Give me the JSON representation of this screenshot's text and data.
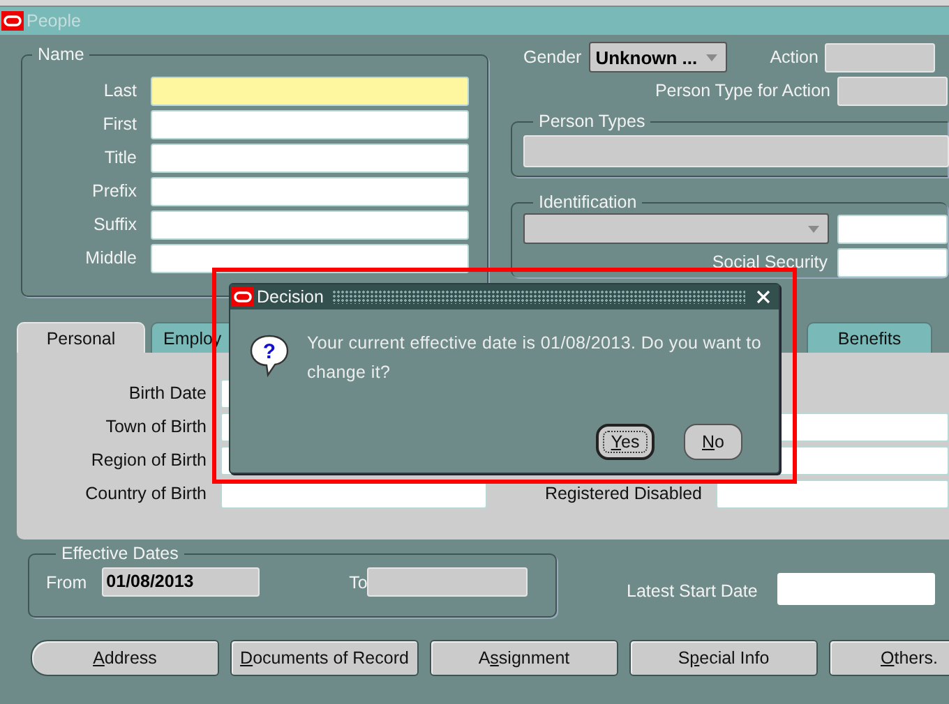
{
  "window": {
    "title": "People"
  },
  "name_group": {
    "title": "Name",
    "fields": [
      {
        "label": "Last",
        "focused": true
      },
      {
        "label": "First",
        "focused": false
      },
      {
        "label": "Title",
        "focused": false
      },
      {
        "label": "Prefix",
        "focused": false
      },
      {
        "label": "Suffix",
        "focused": false
      },
      {
        "label": "Middle",
        "focused": false
      }
    ]
  },
  "gender": {
    "label": "Gender",
    "value": "Unknown ..."
  },
  "action": {
    "label": "Action"
  },
  "person_type_for_action": {
    "label": "Person Type for Action"
  },
  "person_types": {
    "title": "Person Types"
  },
  "identification": {
    "title": "Identification",
    "social_security_label": "Social Security"
  },
  "tabs": [
    {
      "label": "Personal",
      "selected": true
    },
    {
      "label": "Employ",
      "selected": false
    },
    {
      "label": "Benefits",
      "selected": false
    }
  ],
  "personal_fields": [
    {
      "label": "Birth Date"
    },
    {
      "label": "Town of Birth"
    },
    {
      "label": "Region of Birth"
    },
    {
      "label": "Country of Birth"
    }
  ],
  "registered_disabled_label": "Registered Disabled",
  "effective_dates": {
    "title": "Effective Dates",
    "from_label": "From",
    "from_value": "01/08/2013",
    "to_label": "To"
  },
  "latest_start_date": {
    "label": "Latest Start Date"
  },
  "buttons": [
    {
      "key": "A",
      "after": "ddress"
    },
    {
      "key": "D",
      "after": "ocuments of Record"
    },
    {
      "before": "A",
      "key": "s",
      "after": "signment"
    },
    {
      "before": "S",
      "key": "p",
      "after": "ecial Info"
    },
    {
      "key": "O",
      "after": "thers."
    }
  ],
  "dialog": {
    "title": "Decision",
    "icon_glyph": "?",
    "message": "Your current effective date is 01/08/2013. Do you want to change it?",
    "buttons": [
      {
        "key": "Y",
        "after": "es",
        "default": true
      },
      {
        "key": "N",
        "after": "o",
        "default": false
      }
    ]
  }
}
